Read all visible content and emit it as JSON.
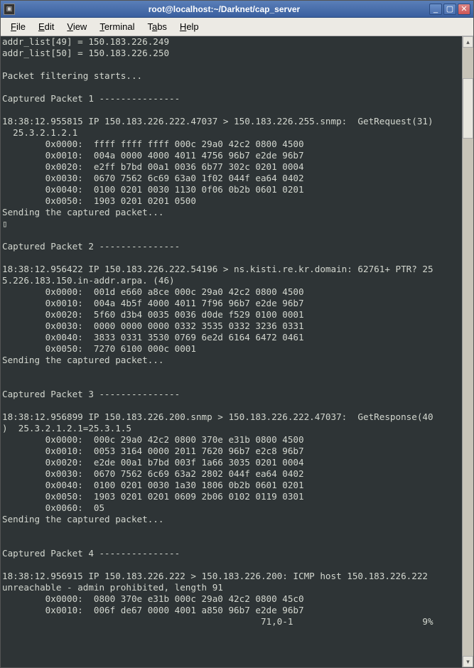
{
  "window": {
    "title": "root@localhost:~/Darknet/cap_server"
  },
  "menubar": [
    {
      "label": "File",
      "accel": "F"
    },
    {
      "label": "Edit",
      "accel": "E"
    },
    {
      "label": "View",
      "accel": "V"
    },
    {
      "label": "Terminal",
      "accel": "T"
    },
    {
      "label": "Tabs",
      "accel": "a"
    },
    {
      "label": "Help",
      "accel": "H"
    }
  ],
  "buttons": {
    "min": "_",
    "max": "▢",
    "close": "✕"
  },
  "terminal": {
    "status_pos": "71,0-1",
    "status_pct": "9%",
    "lines": [
      "addr_list[49] = 150.183.226.249",
      "addr_list[50] = 150.183.226.250",
      "",
      "Packet filtering starts...",
      "",
      "Captured Packet 1 ---------------",
      "",
      "18:38:12.955815 IP 150.183.226.222.47037 > 150.183.226.255.snmp:  GetRequest(31)",
      "  25.3.2.1.2.1",
      "        0x0000:  ffff ffff ffff 000c 29a0 42c2 0800 4500",
      "        0x0010:  004a 0000 4000 4011 4756 96b7 e2de 96b7",
      "        0x0020:  e2ff b7bd 00a1 0036 6b77 302c 0201 0004",
      "        0x0030:  0670 7562 6c69 63a0 1f02 044f ea64 0402",
      "        0x0040:  0100 0201 0030 1130 0f06 0b2b 0601 0201",
      "        0x0050:  1903 0201 0201 0500",
      "Sending the captured packet...",
      "▯",
      "",
      "Captured Packet 2 ---------------",
      "",
      "18:38:12.956422 IP 150.183.226.222.54196 > ns.kisti.re.kr.domain: 62761+ PTR? 25",
      "5.226.183.150.in-addr.arpa. (46)",
      "        0x0000:  001d e660 a8ce 000c 29a0 42c2 0800 4500",
      "        0x0010:  004a 4b5f 4000 4011 7f96 96b7 e2de 96b7",
      "        0x0020:  5f60 d3b4 0035 0036 d0de f529 0100 0001",
      "        0x0030:  0000 0000 0000 0332 3535 0332 3236 0331",
      "        0x0040:  3833 0331 3530 0769 6e2d 6164 6472 0461",
      "        0x0050:  7270 6100 000c 0001",
      "Sending the captured packet...",
      "",
      "",
      "Captured Packet 3 ---------------",
      "",
      "18:38:12.956899 IP 150.183.226.200.snmp > 150.183.226.222.47037:  GetResponse(40",
      ")  25.3.2.1.2.1=25.3.1.5",
      "        0x0000:  000c 29a0 42c2 0800 370e e31b 0800 4500",
      "        0x0010:  0053 3164 0000 2011 7620 96b7 e2c8 96b7",
      "        0x0020:  e2de 00a1 b7bd 003f 1a66 3035 0201 0004",
      "        0x0030:  0670 7562 6c69 63a2 2802 044f ea64 0402",
      "        0x0040:  0100 0201 0030 1a30 1806 0b2b 0601 0201",
      "        0x0050:  1903 0201 0201 0609 2b06 0102 0119 0301",
      "        0x0060:  05",
      "Sending the captured packet...",
      "",
      "",
      "Captured Packet 4 ---------------",
      "",
      "18:38:12.956915 IP 150.183.226.222 > 150.183.226.200: ICMP host 150.183.226.222 ",
      "unreachable - admin prohibited, length 91",
      "        0x0000:  0800 370e e31b 000c 29a0 42c2 0800 45c0",
      "        0x0010:  006f de67 0000 4001 a850 96b7 e2de 96b7"
    ]
  }
}
